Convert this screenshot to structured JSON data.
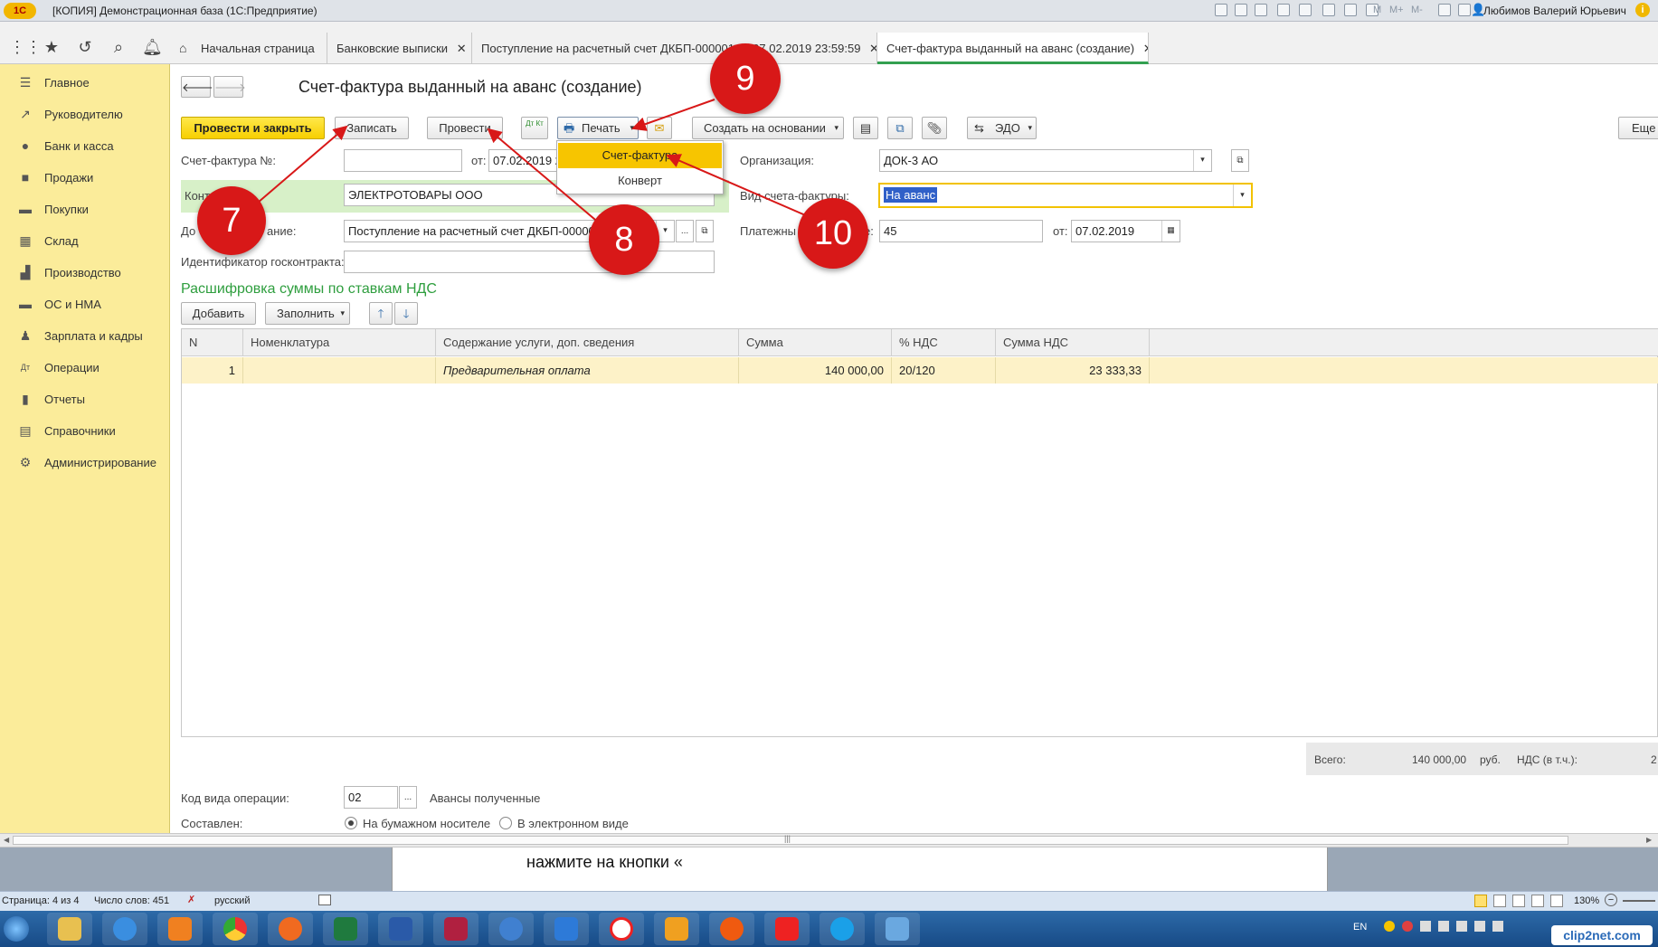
{
  "window": {
    "logo": "1С",
    "title": "[КОПИЯ] Демонстрационная база  (1С:Предприятие)",
    "user": "Любимов Валерий Юрьевич",
    "toolbar_glyphs": {
      "m": "M",
      "mplus": "M+",
      "mminus": "M-"
    }
  },
  "tabs": [
    {
      "label": "Начальная страница"
    },
    {
      "label": "Банковские выписки"
    },
    {
      "label": "Поступление на расчетный счет ДКБП-000001 от 07.02.2019 23:59:59"
    },
    {
      "label": "Счет-фактура выданный на аванс (создание)"
    }
  ],
  "tab_close": "✕",
  "sidebar": {
    "items": [
      {
        "label": "Главное",
        "icon": "menu-icon"
      },
      {
        "label": "Руководителю",
        "icon": "trend-icon"
      },
      {
        "label": "Банк и касса",
        "icon": "coin-icon"
      },
      {
        "label": "Продажи",
        "icon": "bag-icon"
      },
      {
        "label": "Покупки",
        "icon": "cart-icon"
      },
      {
        "label": "Склад",
        "icon": "grid-icon"
      },
      {
        "label": "Производство",
        "icon": "factory-icon"
      },
      {
        "label": "ОС и НМА",
        "icon": "truck-icon"
      },
      {
        "label": "Зарплата и кадры",
        "icon": "person-icon"
      },
      {
        "label": "Операции",
        "icon": "dtkt-icon"
      },
      {
        "label": "Отчеты",
        "icon": "bars-icon"
      },
      {
        "label": "Справочники",
        "icon": "book-icon"
      },
      {
        "label": "Администрирование",
        "icon": "gear-icon"
      }
    ]
  },
  "form": {
    "title": "Счет-фактура выданный на аванс (создание)",
    "buttons": {
      "post_close": "Провести и закрыть",
      "save": "Записать",
      "post": "Провести",
      "dtkt": "Дт Кт",
      "print": "Печать",
      "create_based": "Создать на основании",
      "edo": "ЭДО",
      "more": "Еще"
    },
    "print_menu": [
      "Счет-фактура",
      "Конверт"
    ],
    "fields": {
      "number_label": "Счет-фактура №:",
      "number_value": "",
      "date_label": "от:",
      "date_value": "07.02.2019 2",
      "org_label": "Организация:",
      "org_value": "ДОК-3 АО",
      "contractor_label": "Конт",
      "contractor_value": "ЭЛЕКТРОТОВАРЫ ООО",
      "type_label": "Вид счета-фактуры:",
      "type_value": "На аванс",
      "base_label": "До",
      "base_label_tail": "ание:",
      "base_value": "Поступление на расчетный счет ДКБП-00000",
      "payment_label": "Платежны",
      "payment_label_tail": "е:",
      "payment_value": "45",
      "payment_date_label": "от:",
      "payment_date_value": "07.02.2019",
      "gov_label": "Идентификатор госконтракта:",
      "gov_value": ""
    },
    "section_title": "Расшифровка суммы по ставкам НДС",
    "table_buttons": {
      "add": "Добавить",
      "fill": "Заполнить"
    },
    "table": {
      "columns": [
        "N",
        "Номенклатура",
        "Содержание услуги, доп. сведения",
        "Сумма",
        "% НДС",
        "Сумма НДС"
      ],
      "rows": [
        [
          "1",
          "",
          "Предварительная оплата",
          "140 000,00",
          "20/120",
          "23 333,33"
        ]
      ]
    },
    "totals": {
      "label": "Всего:",
      "sum": "140 000,00",
      "currency": "руб.",
      "vat_label": "НДС (в т.ч.):",
      "vat_value": "2"
    },
    "op_code_label": "Код вида операции:",
    "op_code_value": "02",
    "op_code_text": "Авансы полученные",
    "compiled_label": "Составлен:",
    "compiled_options": [
      "На бумажном носителе",
      "В электронном виде"
    ]
  },
  "annotations": [
    "7",
    "8",
    "9",
    "10"
  ],
  "annotation_color": "#d81818",
  "document_text": "нажмите на кнопки «",
  "statusbar": {
    "page": "Страница: 4 из 4",
    "words": "Число слов: 451",
    "lang": "русский",
    "zoom": "130%",
    "input_lang": "EN"
  },
  "clip": "clip2net.com",
  "markers": {
    "split_dots": "...",
    "scroll_grip": "|||"
  }
}
